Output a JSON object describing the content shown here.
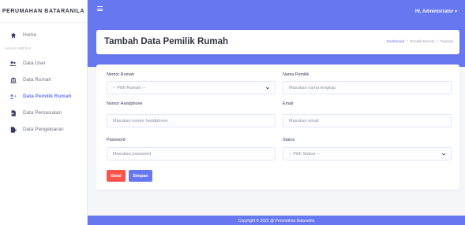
{
  "brand": "PERUMAHAN BATARANILA",
  "menu_header": "MAIN MENU",
  "menu": {
    "home": "Home",
    "user": "Data User",
    "rumah": "Data Rumah",
    "pemilik": "Data Pemilik Rumah",
    "pemasukan": "Data Pemasukan",
    "pengeluaran": "Data Pengeluaran"
  },
  "topbar": {
    "user": "Hi, Administrator ▾"
  },
  "header": {
    "title": "Tambah Data Pemilik Rumah",
    "breadcrumb": [
      "Dashboard",
      "Pemilik Rumah",
      "Tambah"
    ],
    "breadcrumb_sep": "/"
  },
  "form": {
    "nomor_rumah": {
      "label": "Nomor Rumah",
      "value": "-- Pilih Rumah --"
    },
    "nama_pemilik": {
      "label": "Nama Pemilik",
      "placeholder": "Masukan nama lengkap"
    },
    "nomor_hp": {
      "label": "Nomor Handphone",
      "placeholder": "Masukan nomor handphone"
    },
    "email": {
      "label": "Email",
      "placeholder": "Masukan email"
    },
    "password": {
      "label": "Password",
      "placeholder": "Masukan password"
    },
    "status": {
      "label": "Status",
      "value": "-- Pilih Status --"
    },
    "cancel": "Batal",
    "save": "Simpan"
  },
  "footer": "Copyright © 2022 @ Perumahan Bataranila",
  "colors": {
    "primary": "#6777ef",
    "danger": "#fc544b"
  }
}
